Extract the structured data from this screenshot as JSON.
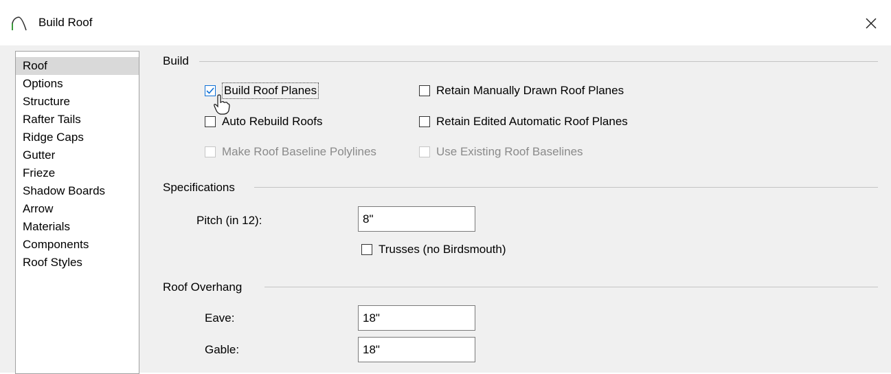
{
  "window": {
    "title": "Build Roof",
    "icon": "roof-arc-icon",
    "close_icon": "close-icon"
  },
  "sidebar": {
    "items": [
      {
        "label": "Roof",
        "selected": true
      },
      {
        "label": "Options"
      },
      {
        "label": "Structure"
      },
      {
        "label": "Rafter Tails"
      },
      {
        "label": "Ridge Caps"
      },
      {
        "label": "Gutter"
      },
      {
        "label": "Frieze"
      },
      {
        "label": "Shadow Boards"
      },
      {
        "label": "Arrow"
      },
      {
        "label": "Materials"
      },
      {
        "label": "Components"
      },
      {
        "label": "Roof Styles"
      }
    ]
  },
  "build": {
    "group_label": "Build",
    "build_roof_planes": {
      "label": "Build Roof Planes",
      "checked": true
    },
    "auto_rebuild_roofs": {
      "label": "Auto Rebuild Roofs",
      "checked": false
    },
    "make_roof_baseline_polylines": {
      "label": "Make Roof Baseline Polylines",
      "checked": false,
      "disabled": true
    },
    "retain_manually_drawn": {
      "label": "Retain Manually Drawn Roof Planes",
      "checked": false
    },
    "retain_edited_automatic": {
      "label": "Retain Edited Automatic Roof Planes",
      "checked": false
    },
    "use_existing_baselines": {
      "label": "Use Existing Roof Baselines",
      "checked": false,
      "disabled": true
    }
  },
  "specifications": {
    "group_label": "Specifications",
    "pitch_label": "Pitch (in 12):",
    "pitch_value": "8\"",
    "trusses": {
      "label": "Trusses (no Birdsmouth)",
      "checked": false
    }
  },
  "overhang": {
    "group_label": "Roof Overhang",
    "eave_label": "Eave:",
    "eave_value": "18\"",
    "gable_label": "Gable:",
    "gable_value": "18\""
  },
  "colors": {
    "dialog_bg": "#f0f0f0",
    "check_accent": "#0d6fd5",
    "selected_item_bg": "#d9d9d9"
  }
}
